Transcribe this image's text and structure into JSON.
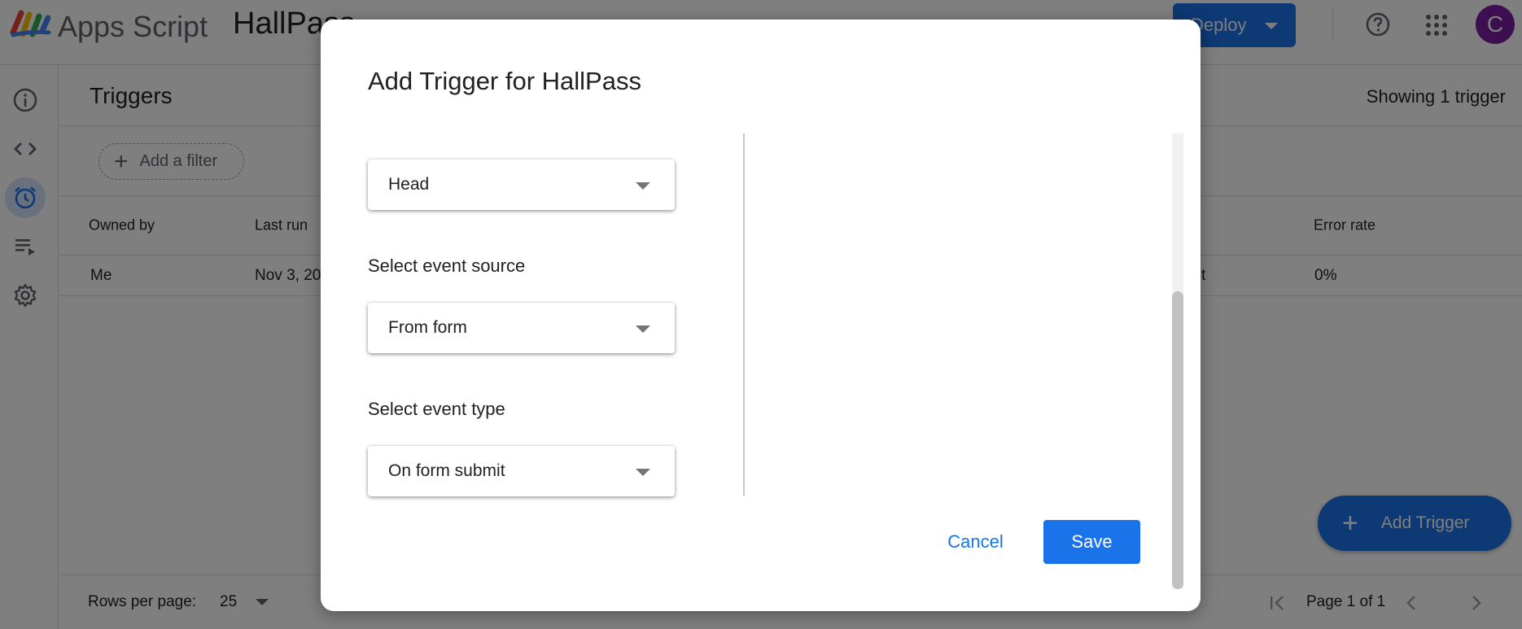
{
  "header": {
    "app_name": "Apps Script",
    "project_name": "HallPass",
    "deploy_label": "Deploy",
    "avatar_initial": "C"
  },
  "sidebar": {
    "items": [
      {
        "icon": "info-icon"
      },
      {
        "icon": "code-icon"
      },
      {
        "icon": "alarm-clock-icon",
        "active": true
      },
      {
        "icon": "executions-icon"
      },
      {
        "icon": "gear-icon"
      }
    ]
  },
  "triggers_page": {
    "title": "Triggers",
    "showing": "Showing 1 trigger",
    "filter_label": "Add a filter",
    "columns": {
      "owned_by": "Owned by",
      "last_run": "Last run",
      "error_rate": "Error rate"
    },
    "row": {
      "owned_by": "Me",
      "last_run": "Nov 3, 20",
      "partial_cell": "t",
      "error_rate": "0%"
    },
    "footer": {
      "rows_per_page_label": "Rows per page:",
      "rows_per_page_value": "25",
      "page_label": "Page 1 of 1"
    },
    "add_trigger_label": "Add Trigger"
  },
  "dialog": {
    "title": "Add Trigger for HallPass",
    "deployment_select_value": "Head",
    "event_source_label": "Select event source",
    "event_source_value": "From form",
    "event_type_label": "Select event type",
    "event_type_value": "On form submit",
    "cancel_label": "Cancel",
    "save_label": "Save"
  },
  "colors": {
    "accent": "#1a73e8",
    "avatar": "#7b1fa2",
    "scrim": "rgba(0,0,0,0.5)",
    "active_rail": "#d2e3fc"
  }
}
